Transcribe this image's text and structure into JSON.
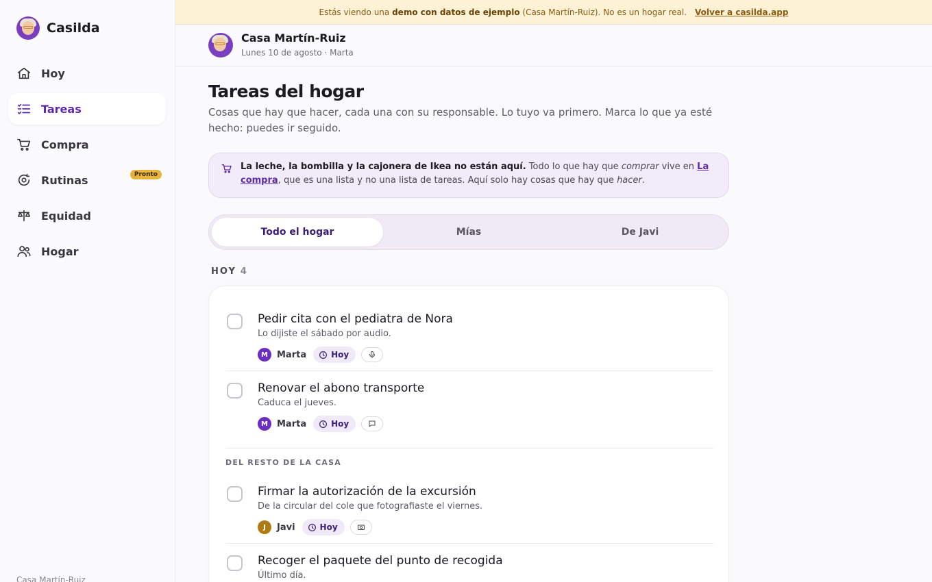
{
  "app": {
    "name": "Casilda"
  },
  "sidebar": {
    "items": [
      {
        "label": "Hoy",
        "icon": "home-icon"
      },
      {
        "label": "Tareas",
        "icon": "tasks-icon",
        "active": true
      },
      {
        "label": "Compra",
        "icon": "cart-icon"
      },
      {
        "label": "Rutinas",
        "icon": "routine-icon",
        "badge": "Pronto"
      },
      {
        "label": "Equidad",
        "icon": "balance-icon"
      },
      {
        "label": "Hogar",
        "icon": "people-icon"
      }
    ],
    "footer": "Casa Martín-Ruiz"
  },
  "banner": {
    "prefix": "Estás viendo una",
    "bold": "demo con datos de ejemplo",
    "suffix": "(Casa Martín-Ruiz). No es un hogar real.",
    "link": "Volver a casilda.app"
  },
  "header": {
    "title": "Casa Martín-Ruiz",
    "subtitle": "Lunes 10 de agosto · Marta"
  },
  "page": {
    "title": "Tareas del hogar",
    "subtitle": "Cosas que hay que hacer, cada una con su responsable. Lo tuyo va primero. Marca lo que ya esté hecho: puedes ir seguido."
  },
  "note": {
    "bold": "La leche, la bombilla y la cajonera de Ikea no están aquí.",
    "text1": "Todo lo que hay que",
    "em1": "comprar",
    "text2": "vive en",
    "link": "La compra",
    "text3": ", que es una lista y no una lista de tareas. Aquí solo hay cosas que hay que",
    "em2": "hacer",
    "text4": "."
  },
  "filters": {
    "options": [
      "Todo el hogar",
      "Mías",
      "De Javi"
    ],
    "selected": "Todo el hogar"
  },
  "section": {
    "label": "HOY",
    "count": "4"
  },
  "subsection": "DEL RESTO DE LA CASA",
  "tasks": [
    {
      "title": "Pedir cita con el pediatra de Nora",
      "desc": "Lo dijiste el sábado por audio.",
      "person": "Marta",
      "initial": "M",
      "person_color": "#6a2fc0",
      "due": "Hoy",
      "source_icon": "microphone-icon"
    },
    {
      "title": "Renovar el abono transporte",
      "desc": "Caduca el jueves.",
      "person": "Marta",
      "initial": "M",
      "person_color": "#6a2fc0",
      "due": "Hoy",
      "source_icon": "message-icon"
    },
    {
      "title": "Firmar la autorización de la excursión",
      "desc": "De la circular del cole que fotografiaste el viernes.",
      "person": "Javi",
      "initial": "J",
      "person_color": "#b07a12",
      "due": "Hoy",
      "source_icon": "camera-icon"
    },
    {
      "title": "Recoger el paquete del punto de recogida",
      "desc": "Último día."
    }
  ],
  "colors": {
    "accent": "#5b2aa8",
    "banner_bg": "#fdf1d6",
    "badge": "#e8b33c"
  }
}
